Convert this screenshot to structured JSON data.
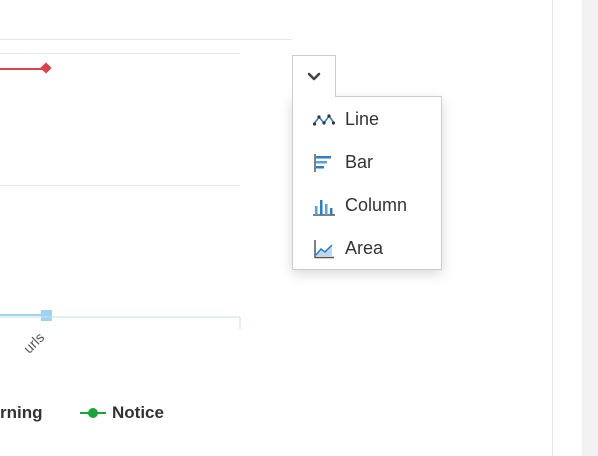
{
  "chart": {
    "x_tick_label": "urls",
    "legend": {
      "warning_partial": "rning",
      "notice": "Notice"
    },
    "colors": {
      "warning_series": "#d9434f",
      "notice_series": "#1aa33a",
      "urls_series": "#9fd3ef"
    }
  },
  "chart_type_menu": {
    "toggle_icon": "chevron-down-icon",
    "items": [
      {
        "label": "Line",
        "icon": "line-chart-icon"
      },
      {
        "label": "Bar",
        "icon": "bar-chart-icon"
      },
      {
        "label": "Column",
        "icon": "column-chart-icon"
      },
      {
        "label": "Area",
        "icon": "area-chart-icon"
      }
    ]
  }
}
